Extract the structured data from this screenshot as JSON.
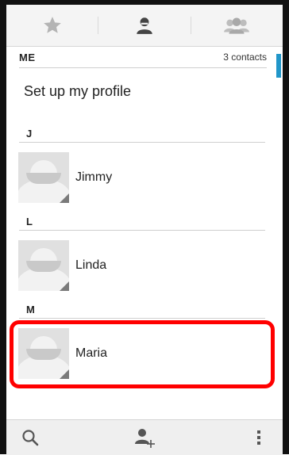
{
  "tabs": [
    {
      "icon": "star-icon",
      "name": "favorites"
    },
    {
      "icon": "person-icon",
      "name": "all-contacts",
      "active": true
    },
    {
      "icon": "group-icon",
      "name": "groups"
    }
  ],
  "me_section": {
    "title": "ME",
    "count": "3 contacts"
  },
  "profile": {
    "label": "Set up my profile"
  },
  "contacts": [
    {
      "letter": "J",
      "name": "Jimmy"
    },
    {
      "letter": "L",
      "name": "Linda"
    },
    {
      "letter": "M",
      "name": "Maria"
    }
  ],
  "bottom_bar": {
    "search_icon": "search-icon",
    "add_contact_icon": "add-contact-icon",
    "overflow_icon": "overflow-menu-icon"
  },
  "colors": {
    "accent": "#2196c9",
    "highlight": "#ff0000"
  }
}
